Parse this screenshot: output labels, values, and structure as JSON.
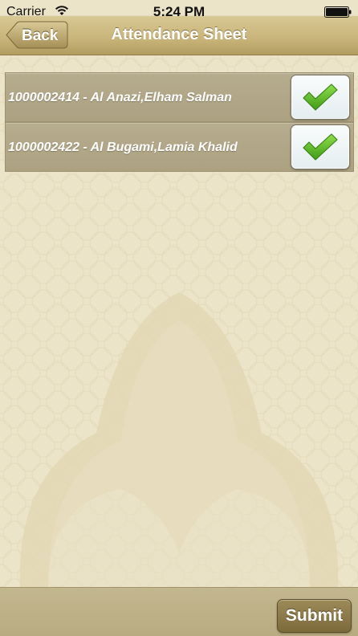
{
  "status_bar": {
    "carrier": "Carrier",
    "time": "5:24 PM",
    "wifi_icon": "wifi-icon",
    "battery_icon": "battery-icon"
  },
  "nav": {
    "title": "Attendance Sheet",
    "back_label": "Back"
  },
  "attendance": {
    "rows": [
      {
        "label": "1000002414 - Al Anazi,Elham Salman",
        "checked": true
      },
      {
        "label": "1000002422 - Al Bugami,Lamia Khalid",
        "checked": true
      }
    ]
  },
  "footer": {
    "submit_label": "Submit"
  },
  "colors": {
    "nav_gold": "#c8b47a",
    "background": "#ece4c9",
    "row_bg": "#b0a686",
    "check_green": "#5fb72a",
    "submit_brown": "#8a7749"
  }
}
